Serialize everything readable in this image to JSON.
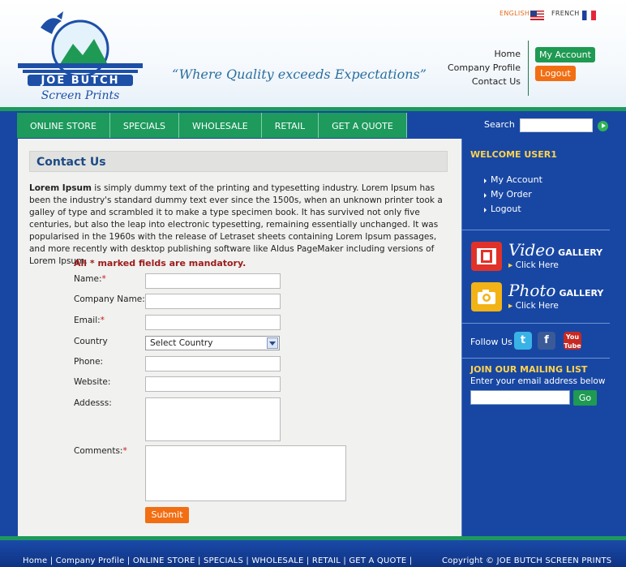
{
  "brand": {
    "logo_name": "JOE BUTCH",
    "logo_sub": "Screen Prints",
    "tagline": "“Where Quality exceeds Expectations”"
  },
  "languages": [
    "ENGLISH",
    "FRENCH"
  ],
  "toplinks": [
    "Home",
    "Company Profile",
    "Contact Us"
  ],
  "account": {
    "my_account": "My Account",
    "logout": "Logout"
  },
  "nav": [
    "ONLINE STORE",
    "SPECIALS",
    "WHOLESALE",
    "RETAIL",
    "GET A QUOTE"
  ],
  "search": {
    "label": "Search"
  },
  "page": {
    "title": "Contact Us",
    "intro_lead": "Lorem Ipsum",
    "intro_rest": " is simply dummy text of the printing and typesetting industry. Lorem Ipsum has been the industry's standard dummy text ever since the 1500s, when an unknown printer took a galley of type and scrambled it to make a type specimen book. It has survived not only five centuries, but also the leap into electronic typesetting, remaining essentially unchanged. It was popularised in the 1960s with the release of Letraset sheets containing Lorem Ipsum passages, and more recently with desktop publishing software like Aldus PageMaker including versions of Lorem Ipsum."
  },
  "form": {
    "mandatory_note": "All * marked fields are mandatory.",
    "name": "Name:",
    "company": "Company Name:",
    "email": "Email:",
    "country": "Country",
    "country_value": "Select Country",
    "phone": "Phone:",
    "website": "Website:",
    "address": "Addesss:",
    "comments": "Comments:",
    "star": "*",
    "submit": "Submit"
  },
  "sidebar": {
    "welcome": "WELCOME USER1",
    "links": [
      "My Account",
      "My Order",
      "Logout"
    ],
    "video_word": "Video",
    "photo_word": "Photo",
    "gallery_word": "GALLERY",
    "click_here": "Click Here",
    "follow": "Follow Us",
    "mail_title": "JOIN OUR MAILING LIST",
    "mail_sub": "Enter your email address below",
    "mail_go": "Go"
  },
  "footer": {
    "links": "Home  |  Company Profile  |  ONLINE STORE  |  SPECIALS  |  WHOLESALE  |  RETAIL  |  GET A QUOTE  |",
    "copyright": "Copyright © JOE BUTCH SCREEN PRINTS"
  },
  "colors": {
    "nav_green": "#1d9a5c",
    "sidebar_blue": "#1847a3",
    "accent_orange": "#f26e12",
    "title_blue": "#1d4a85",
    "sidebar_yellow": "#ffd34d"
  }
}
